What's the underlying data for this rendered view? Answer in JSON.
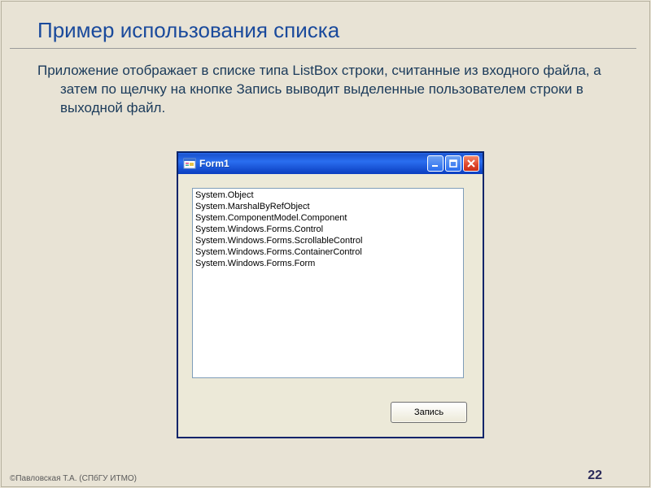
{
  "slide": {
    "title": "Пример использования списка",
    "body": "Приложение отображает в списке типа ListBox строки, считанные из входного файла, а затем по щелчку на кнопке Запись выводит выделенные пользователем строки в выходной файл."
  },
  "window": {
    "title": "Form1",
    "listbox": {
      "items": [
        "System.Object",
        "System.MarshalByRefObject",
        "System.ComponentModel.Component",
        "System.Windows.Forms.Control",
        "System.Windows.Forms.ScrollableControl",
        "System.Windows.Forms.ContainerControl",
        "System.Windows.Forms.Form"
      ]
    },
    "button_label": "Запись"
  },
  "footer": {
    "author": "©Павловская Т.А. (СПбГУ ИТМО)",
    "page": "22"
  }
}
